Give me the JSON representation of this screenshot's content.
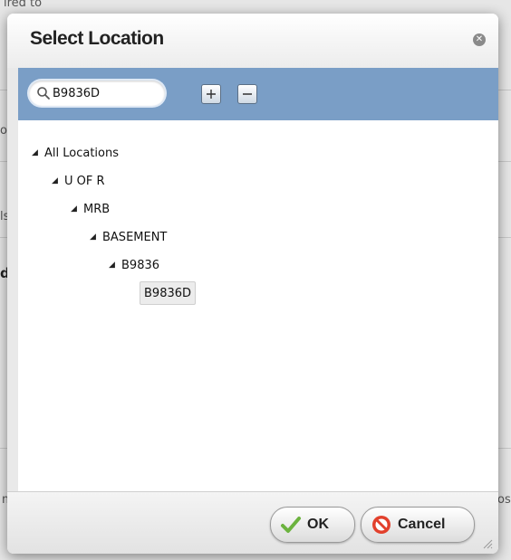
{
  "background": {
    "fragments": [
      "ired to",
      "or,",
      "ls",
      "d",
      "m",
      "os"
    ]
  },
  "dialog": {
    "title": "Select Location",
    "close_icon": "close-icon",
    "search": {
      "value": "B9836D",
      "icon": "search-icon"
    },
    "toolbar": {
      "expand_icon": "plus-square-icon",
      "collapse_icon": "minus-square-icon"
    },
    "tree": [
      {
        "label": "All Locations",
        "expanded": true
      },
      {
        "label": "U OF R",
        "expanded": true
      },
      {
        "label": "MRB",
        "expanded": true
      },
      {
        "label": "BASEMENT",
        "expanded": true
      },
      {
        "label": "B9836",
        "expanded": true
      },
      {
        "label": "B9836D",
        "selected": true
      }
    ],
    "buttons": {
      "ok": "OK",
      "cancel": "Cancel"
    }
  },
  "colors": {
    "toolbar": "#7a9ec6",
    "ok_check": "#6cb33f",
    "cancel_icon": "#e2402c"
  }
}
